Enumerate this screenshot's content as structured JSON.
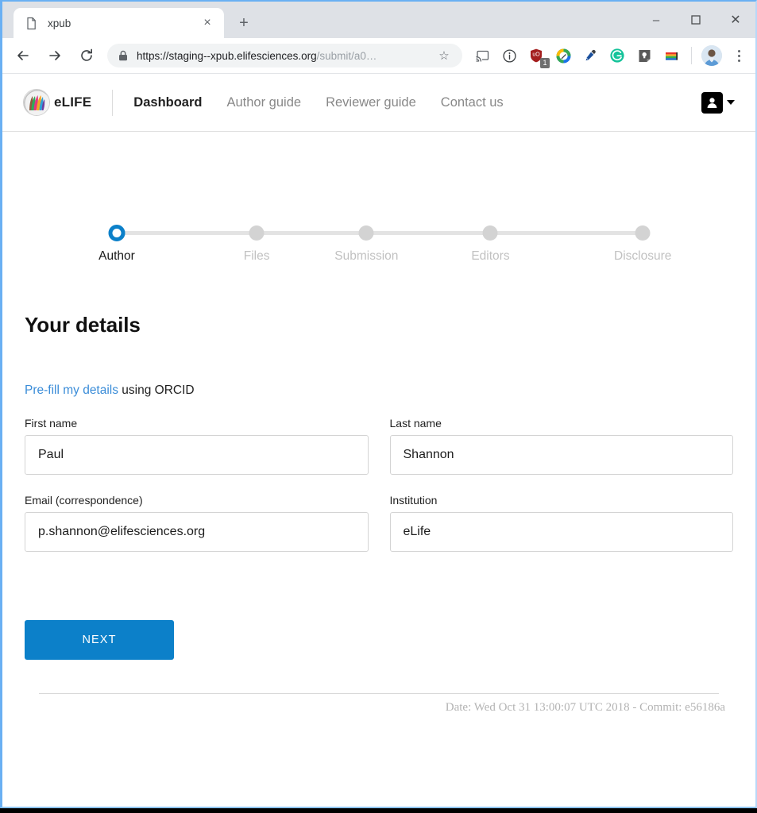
{
  "browser": {
    "tab": {
      "title": "xpub",
      "favicon": "document-icon",
      "close": "×"
    },
    "new_tab": "+",
    "window_controls": {
      "minimize": "–",
      "maximize": "maximize-icon",
      "close": "✕"
    },
    "nav": {
      "back": "back-icon",
      "forward": "forward-icon",
      "reload": "reload-icon"
    },
    "address": {
      "lock": "lock-icon",
      "url_prefix": "https://",
      "url_host": "staging--xpub.elifesciences.org",
      "url_path": "/submit/a0…",
      "star": "☆"
    },
    "extensions": [
      {
        "name": "cast-icon",
        "badge": ""
      },
      {
        "name": "info-circle-icon",
        "badge": ""
      },
      {
        "name": "ublock-shield-icon",
        "badge": "1"
      },
      {
        "name": "color-wheel-pencil-icon",
        "badge": ""
      },
      {
        "name": "eyedropper-icon",
        "badge": ""
      },
      {
        "name": "grammarly-g-icon",
        "badge": ""
      },
      {
        "name": "lightbulb-note-icon",
        "badge": ""
      },
      {
        "name": "rainbow-stack-icon",
        "badge": ""
      }
    ],
    "profile_avatar": "profile-avatar",
    "menu": "kebab-menu-icon"
  },
  "site": {
    "brand": {
      "logo": "elife-logo-icon",
      "name": "eLIFE"
    },
    "nav": [
      {
        "label": "Dashboard",
        "active": true
      },
      {
        "label": "Author guide",
        "active": false
      },
      {
        "label": "Reviewer guide",
        "active": false
      },
      {
        "label": "Contact us",
        "active": false
      }
    ],
    "user_menu": {
      "icon": "user-avatar-icon",
      "caret": "chevron-down-icon"
    }
  },
  "stepper": {
    "steps": [
      {
        "label": "Author",
        "active": true
      },
      {
        "label": "Files",
        "active": false
      },
      {
        "label": "Submission",
        "active": false
      },
      {
        "label": "Editors",
        "active": false
      },
      {
        "label": "Disclosure",
        "active": false
      }
    ]
  },
  "form": {
    "title": "Your details",
    "prefill_link": "Pre-fill my details",
    "prefill_rest": " using ORCID",
    "fields": {
      "first_name": {
        "label": "First name",
        "value": "Paul",
        "placeholder": ""
      },
      "last_name": {
        "label": "Last name",
        "value": "Shannon",
        "placeholder": ""
      },
      "email": {
        "label": "Email (correspondence)",
        "value": "p.shannon@elifesciences.org",
        "placeholder": ""
      },
      "institution": {
        "label": "Institution",
        "value": "eLife",
        "placeholder": ""
      }
    },
    "submit_label": "NEXT"
  },
  "footer": {
    "text": "Date: Wed Oct 31 13:00:07 UTC 2018 - Commit: e56186a"
  },
  "colors": {
    "accent_blue": "#0c80c9",
    "link_blue": "#3a8cd8",
    "step_inactive": "#d3d3d3",
    "text_dark": "#1a1a1a",
    "text_muted": "#888888"
  }
}
